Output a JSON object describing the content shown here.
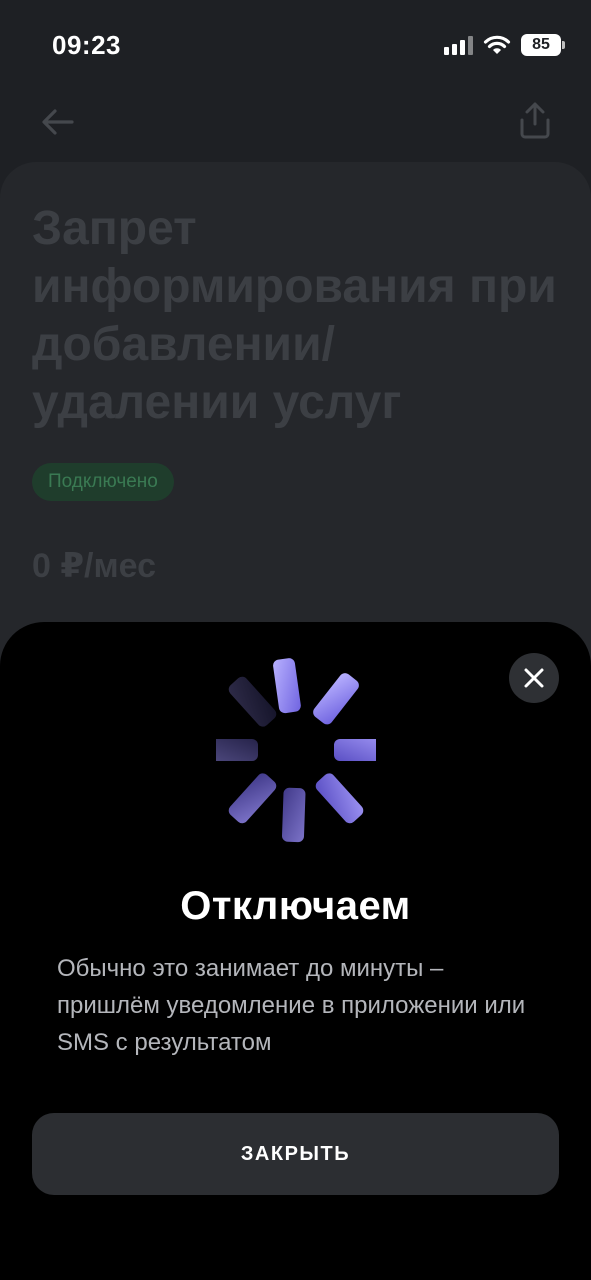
{
  "status_bar": {
    "time": "09:23",
    "battery": "85",
    "icons": [
      "signal-icon",
      "wifi-icon",
      "battery-icon"
    ]
  },
  "header": {
    "icons": [
      "back-arrow-icon",
      "share-icon"
    ]
  },
  "service": {
    "title": "Запрет информирования при добавлении/удалении услуг",
    "status": "Подключено",
    "price": "0 ₽/мес"
  },
  "sheet": {
    "icons": [
      "close-icon",
      "loading-spinner-icon"
    ],
    "title": "Отключаем",
    "description": "Обычно это занимает до минуты – пришлём уведомление в приложении или SMS с результатом",
    "button_label": "ЗАКРЫТЬ"
  },
  "colors": {
    "accent": "#8b80f0",
    "background": "#1e2024",
    "sheet_background": "#000000",
    "status_badge_bg": "#1f3d2c",
    "status_badge_text": "#3a7a53"
  }
}
